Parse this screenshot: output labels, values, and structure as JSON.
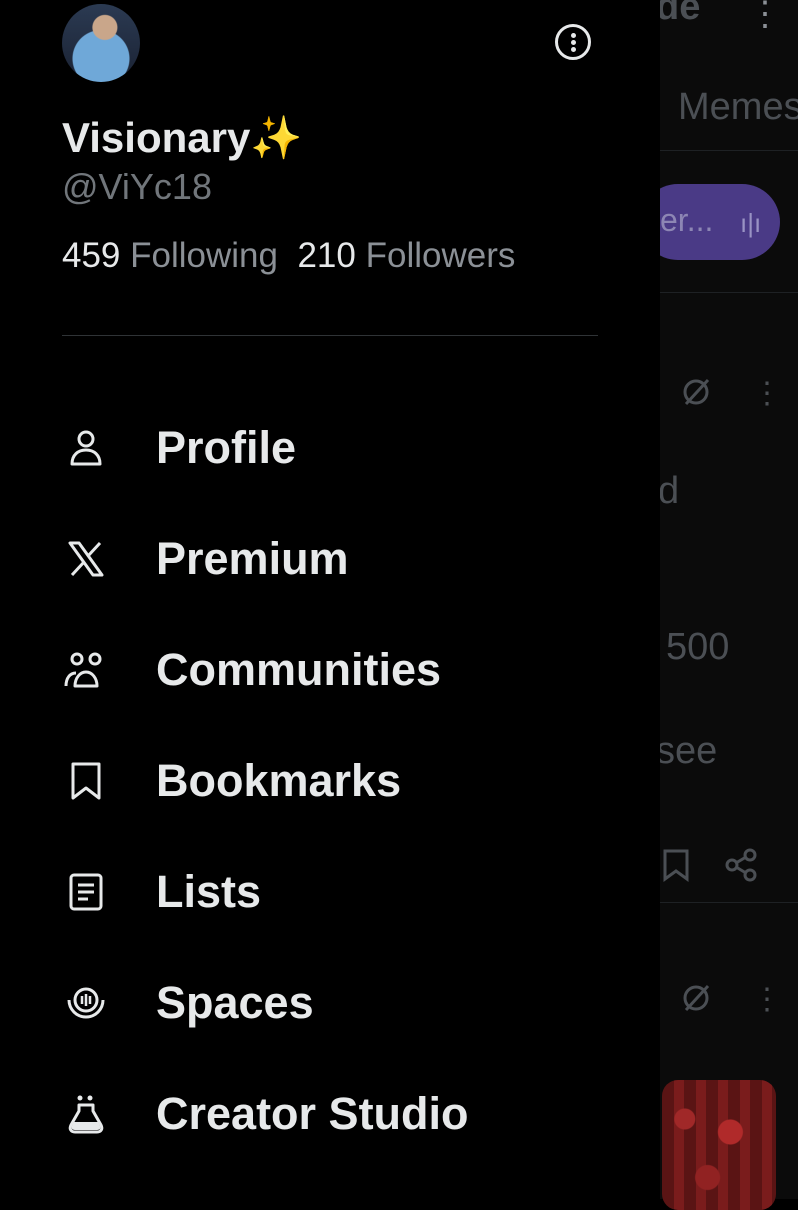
{
  "feed": {
    "top_fragment": "de",
    "tab_fragment": "Memes",
    "spaces_pill_text": "er...",
    "post_fragment_1": "d",
    "post_fragment_2": "500",
    "post_fragment_3": "see"
  },
  "drawer": {
    "display_name": "Visionary✨",
    "handle": "@ViYc18",
    "following_count": "459",
    "following_label": "Following",
    "followers_count": "210",
    "followers_label": "Followers",
    "menu": [
      {
        "label": "Profile",
        "icon": "person-icon"
      },
      {
        "label": "Premium",
        "icon": "x-logo-icon"
      },
      {
        "label": "Communities",
        "icon": "communities-icon"
      },
      {
        "label": "Bookmarks",
        "icon": "bookmark-icon"
      },
      {
        "label": "Lists",
        "icon": "list-icon"
      },
      {
        "label": "Spaces",
        "icon": "spaces-icon"
      },
      {
        "label": "Creator Studio",
        "icon": "flask-icon"
      }
    ]
  },
  "colors": {
    "background": "#000000",
    "text_primary": "#e7e9ea",
    "text_secondary": "#71767b",
    "divider": "#2f3336",
    "spaces_pill": "#4a3a86"
  }
}
